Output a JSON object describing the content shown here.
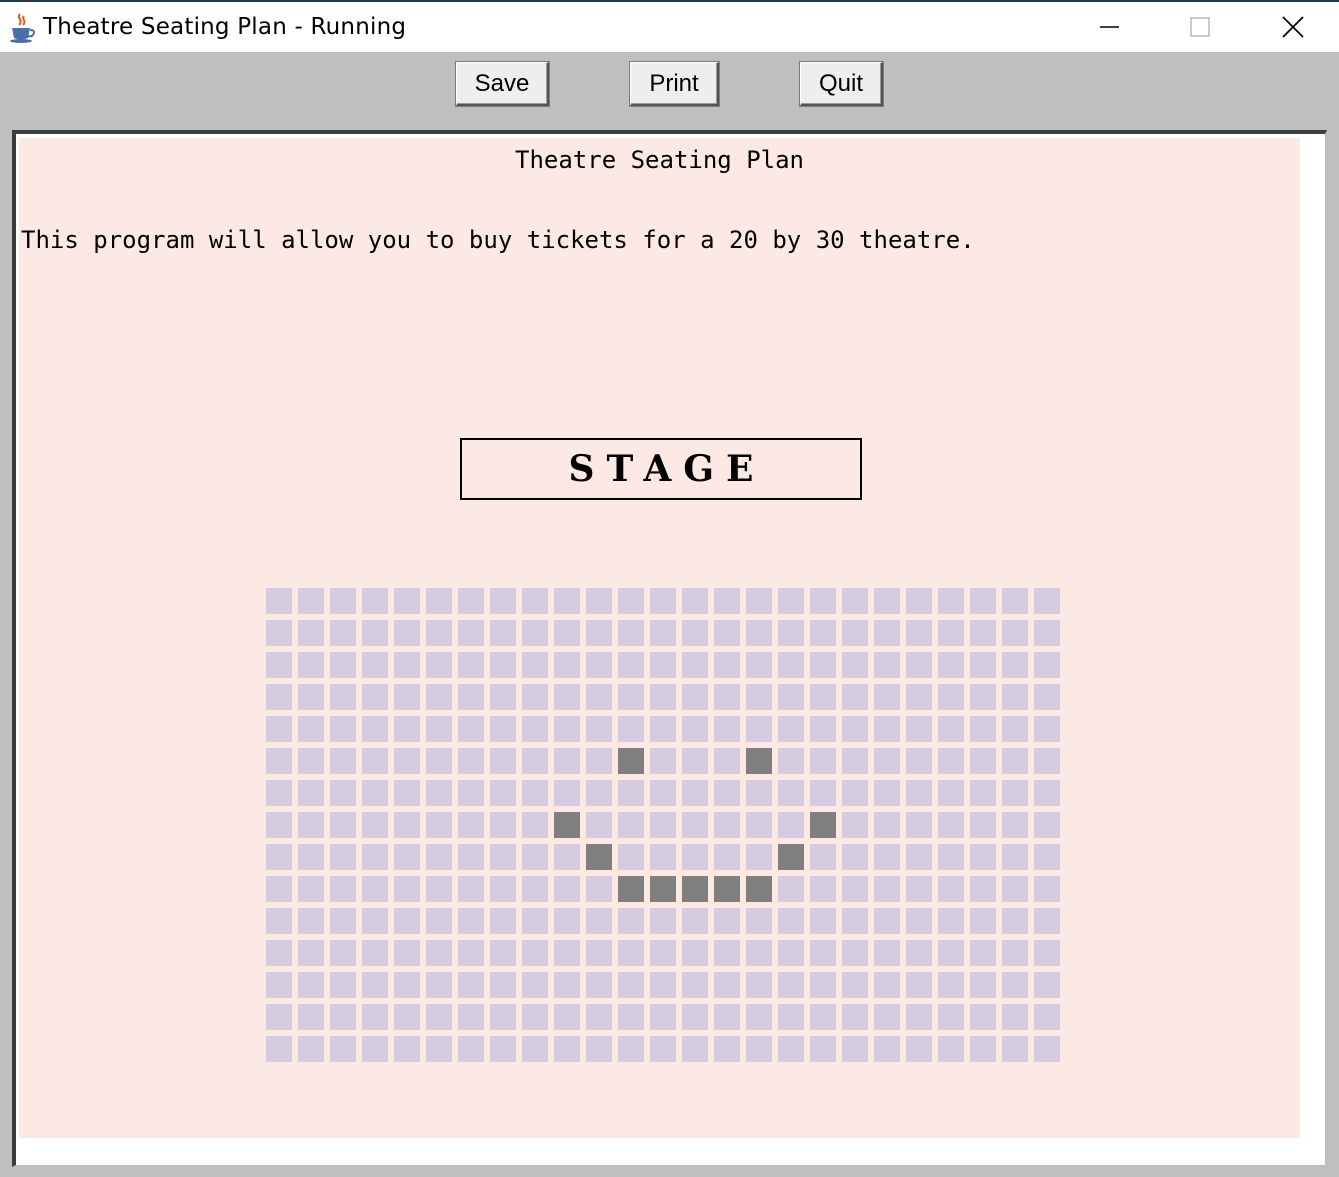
{
  "window": {
    "title": "Theatre Seating Plan - Running",
    "icon": "java-cup-icon"
  },
  "toolbar": {
    "save_label": "Save",
    "print_label": "Print",
    "quit_label": "Quit"
  },
  "content": {
    "heading": "Theatre Seating Plan",
    "intro": "This program will allow you to buy tickets for a 20 by 30 theatre.",
    "stage_label": "STAGE"
  },
  "seating": {
    "rows": 15,
    "cols": 25,
    "available_color": "#d5cbe1",
    "taken_color": "#7f7f7f",
    "taken_seats": [
      {
        "row": 5,
        "col": 11
      },
      {
        "row": 5,
        "col": 15
      },
      {
        "row": 7,
        "col": 9
      },
      {
        "row": 7,
        "col": 17
      },
      {
        "row": 8,
        "col": 10
      },
      {
        "row": 8,
        "col": 16
      },
      {
        "row": 9,
        "col": 11
      },
      {
        "row": 9,
        "col": 12
      },
      {
        "row": 9,
        "col": 13
      },
      {
        "row": 9,
        "col": 14
      },
      {
        "row": 9,
        "col": 15
      }
    ]
  },
  "colors": {
    "canvas_background": "#fde9e4",
    "toolbar_background": "#bfbfbf"
  }
}
